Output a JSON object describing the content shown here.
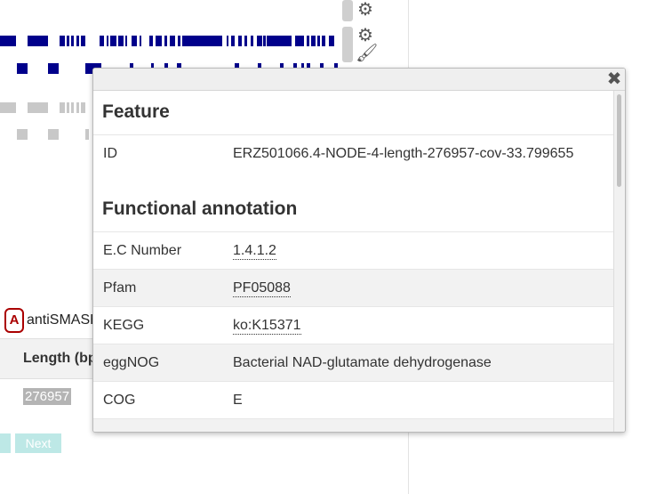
{
  "background": {
    "legend": {
      "badge": "A",
      "label": "antiSMASH"
    },
    "table": {
      "header": "Length (bp)",
      "value": "276957"
    },
    "pager": {
      "next_label": "Next"
    }
  },
  "modal": {
    "close_icon": "close-icon",
    "feature": {
      "title": "Feature",
      "rows": [
        {
          "key": "ID",
          "value": "ERZ501066.4-NODE-4-length-276957-cov-33.799655"
        }
      ]
    },
    "functional": {
      "title": "Functional annotation",
      "rows": [
        {
          "key": "E.C Number",
          "value": "1.4.1.2",
          "link": true
        },
        {
          "key": "Pfam",
          "value": "PF05088",
          "link": true
        },
        {
          "key": "KEGG",
          "value": "ko:K15371",
          "link": true
        },
        {
          "key": "eggNOG",
          "value": "Bacterial NAD-glutamate dehydrogenase",
          "link": false
        },
        {
          "key": "COG",
          "value": "E",
          "link": false
        }
      ]
    }
  },
  "colors": {
    "track_dark": "#00008b",
    "track_grey": "#c8c8c8",
    "pager": "#bde8e6",
    "legend_red": "#aa0000"
  }
}
